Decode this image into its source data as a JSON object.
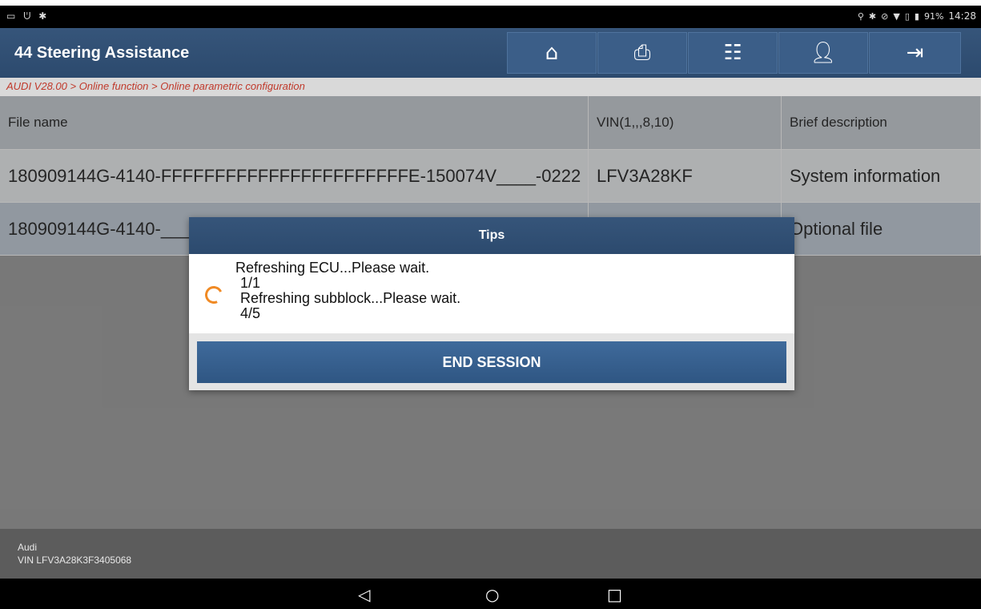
{
  "status_bar": {
    "left_icons": [
      "▭",
      "ᕫ",
      "✱"
    ],
    "battery": "91%",
    "time": "14:28"
  },
  "header": {
    "title": "44 Steering Assistance",
    "buttons": [
      "home-icon",
      "print-icon",
      "report-icon",
      "user-icon",
      "exit-icon"
    ]
  },
  "breadcrumb": "AUDI V28.00 > Online function > Online parametric configuration",
  "table": {
    "columns": [
      "File name",
      "VIN(1,,,8,10)",
      "Brief description"
    ],
    "rows": [
      [
        "180909144G-4140-FFFFFFFFFFFFFFFFFFFFFFFE-150074V____-0222",
        "LFV3A28KF",
        "System information"
      ],
      [
        "180909144G-4140-____",
        "",
        "Optional file"
      ]
    ]
  },
  "dialog": {
    "title": "Tips",
    "lines": [
      "Refreshing ECU...Please wait.",
      "1/1",
      "Refreshing subblock...Please wait.",
      "4/5"
    ],
    "end_button": "END SESSION"
  },
  "footer": {
    "make": "Audi",
    "vin": "VIN LFV3A28K3F3405068"
  },
  "colors": {
    "header_bg": "#2f4e73",
    "accent_spinner": "#f08a24",
    "breadcrumb_text": "#c0392b"
  }
}
